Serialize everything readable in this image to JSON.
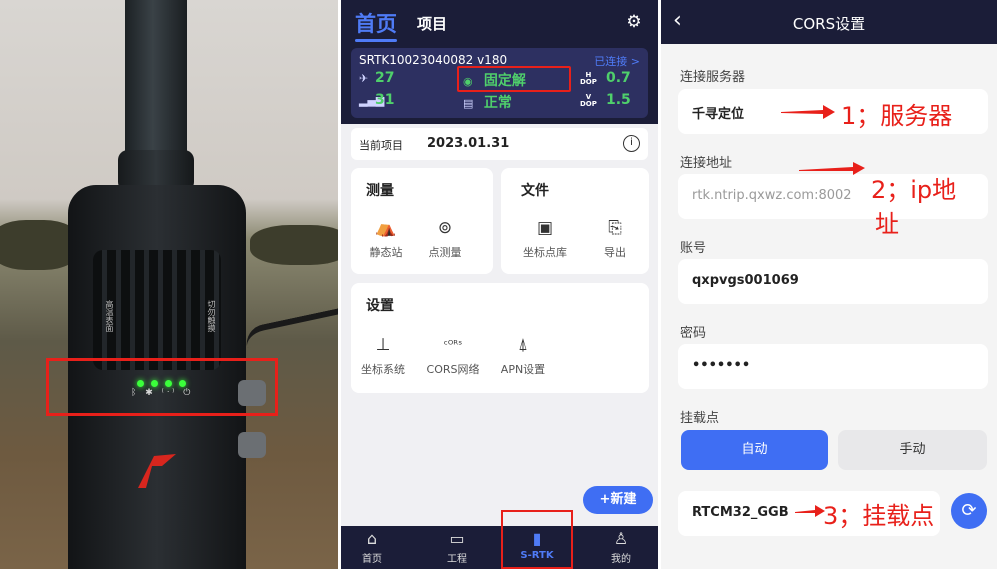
{
  "photo": {
    "side_left": "高温表面",
    "side_right": "切勿触摸",
    "led_icons": "ᛒ ✱ ⁽ᐧ⁾ ⏻"
  },
  "home": {
    "tab_home": "首页",
    "tab_project": "项目",
    "device_id": "SRTK10023040082 v180",
    "connected": "已连接 >",
    "sat_count": "27",
    "fix_status": "固定解",
    "hdop_label": "H\nDOP",
    "hdop": "0.7",
    "signal_count": "31",
    "sd_status": "正常",
    "vdop_label": "V\nDOP",
    "vdop": "1.5",
    "current_project_label": "当前项目",
    "current_project_value": "2023.01.31",
    "survey_title": "测量",
    "survey_items": [
      "静态站",
      "点测量"
    ],
    "file_title": "文件",
    "file_items": [
      "坐标点库",
      "导出"
    ],
    "settings_title": "设置",
    "settings_items": [
      "坐标系统",
      "CORS网络",
      "APN设置"
    ],
    "new_button": "+新建",
    "tabs": [
      "首页",
      "工程",
      "S-RTK",
      "我的"
    ]
  },
  "cors": {
    "title": "CORS设置",
    "server_label": "连接服务器",
    "server_value": "千寻定位",
    "address_label": "连接地址",
    "address_value": "rtk.ntrip.qxwz.com:8002",
    "account_label": "账号",
    "account_value": "qxpvgs001069",
    "password_label": "密码",
    "password_value": "•••••••",
    "mount_label": "挂载点",
    "auto_button": "自动",
    "manual_button": "手动",
    "mount_value": "RTCM32_GGB",
    "anno_1": "1；服务器",
    "anno_2a": "2；ip地",
    "anno_2b": "址",
    "anno_3": "3；挂载点"
  },
  "colors": {
    "accent": "#3f6ef3",
    "dark_bar": "#1b1d38",
    "annotation_red": "#e8201a",
    "fix_green": "#4fd06b"
  }
}
